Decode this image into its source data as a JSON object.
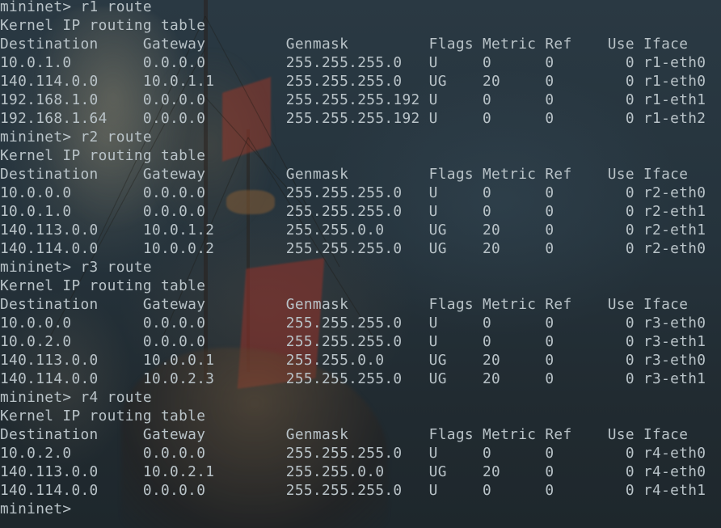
{
  "window": {
    "background": "#24313a",
    "text_color": "#b9c3c8"
  },
  "terminal": {
    "lines": [
      "mininet> r1 route",
      "Kernel IP routing table",
      "Destination     Gateway         Genmask         Flags Metric Ref    Use Iface",
      "10.0.1.0        0.0.0.0         255.255.255.0   U     0      0        0 r1-eth0",
      "140.114.0.0     10.0.1.1        255.255.255.0   UG    20     0        0 r1-eth0",
      "192.168.1.0     0.0.0.0         255.255.255.192 U     0      0        0 r1-eth1",
      "192.168.1.64    0.0.0.0         255.255.255.192 U     0      0        0 r1-eth2",
      "mininet> r2 route",
      "Kernel IP routing table",
      "Destination     Gateway         Genmask         Flags Metric Ref    Use Iface",
      "10.0.0.0        0.0.0.0         255.255.255.0   U     0      0        0 r2-eth0",
      "10.0.1.0        0.0.0.0         255.255.255.0   U     0      0        0 r2-eth1",
      "140.113.0.0     10.0.1.2        255.255.0.0     UG    20     0        0 r2-eth1",
      "140.114.0.0     10.0.0.2        255.255.255.0   UG    20     0        0 r2-eth0",
      "mininet> r3 route",
      "Kernel IP routing table",
      "Destination     Gateway         Genmask         Flags Metric Ref    Use Iface",
      "10.0.0.0        0.0.0.0         255.255.255.0   U     0      0        0 r3-eth0",
      "10.0.2.0        0.0.0.0         255.255.255.0   U     0      0        0 r3-eth1",
      "140.113.0.0     10.0.0.1        255.255.0.0     UG    20     0        0 r3-eth0",
      "140.114.0.0     10.0.2.3        255.255.255.0   UG    20     0        0 r3-eth1",
      "mininet> r4 route",
      "Kernel IP routing table",
      "Destination     Gateway         Genmask         Flags Metric Ref    Use Iface",
      "10.0.2.0        0.0.0.0         255.255.255.0   U     0      0        0 r4-eth0",
      "140.113.0.0     10.0.2.1        255.255.0.0     UG    20     0        0 r4-eth0",
      "140.114.0.0     0.0.0.0         255.255.255.0   U     0      0        0 r4-eth1",
      "mininet> "
    ]
  }
}
